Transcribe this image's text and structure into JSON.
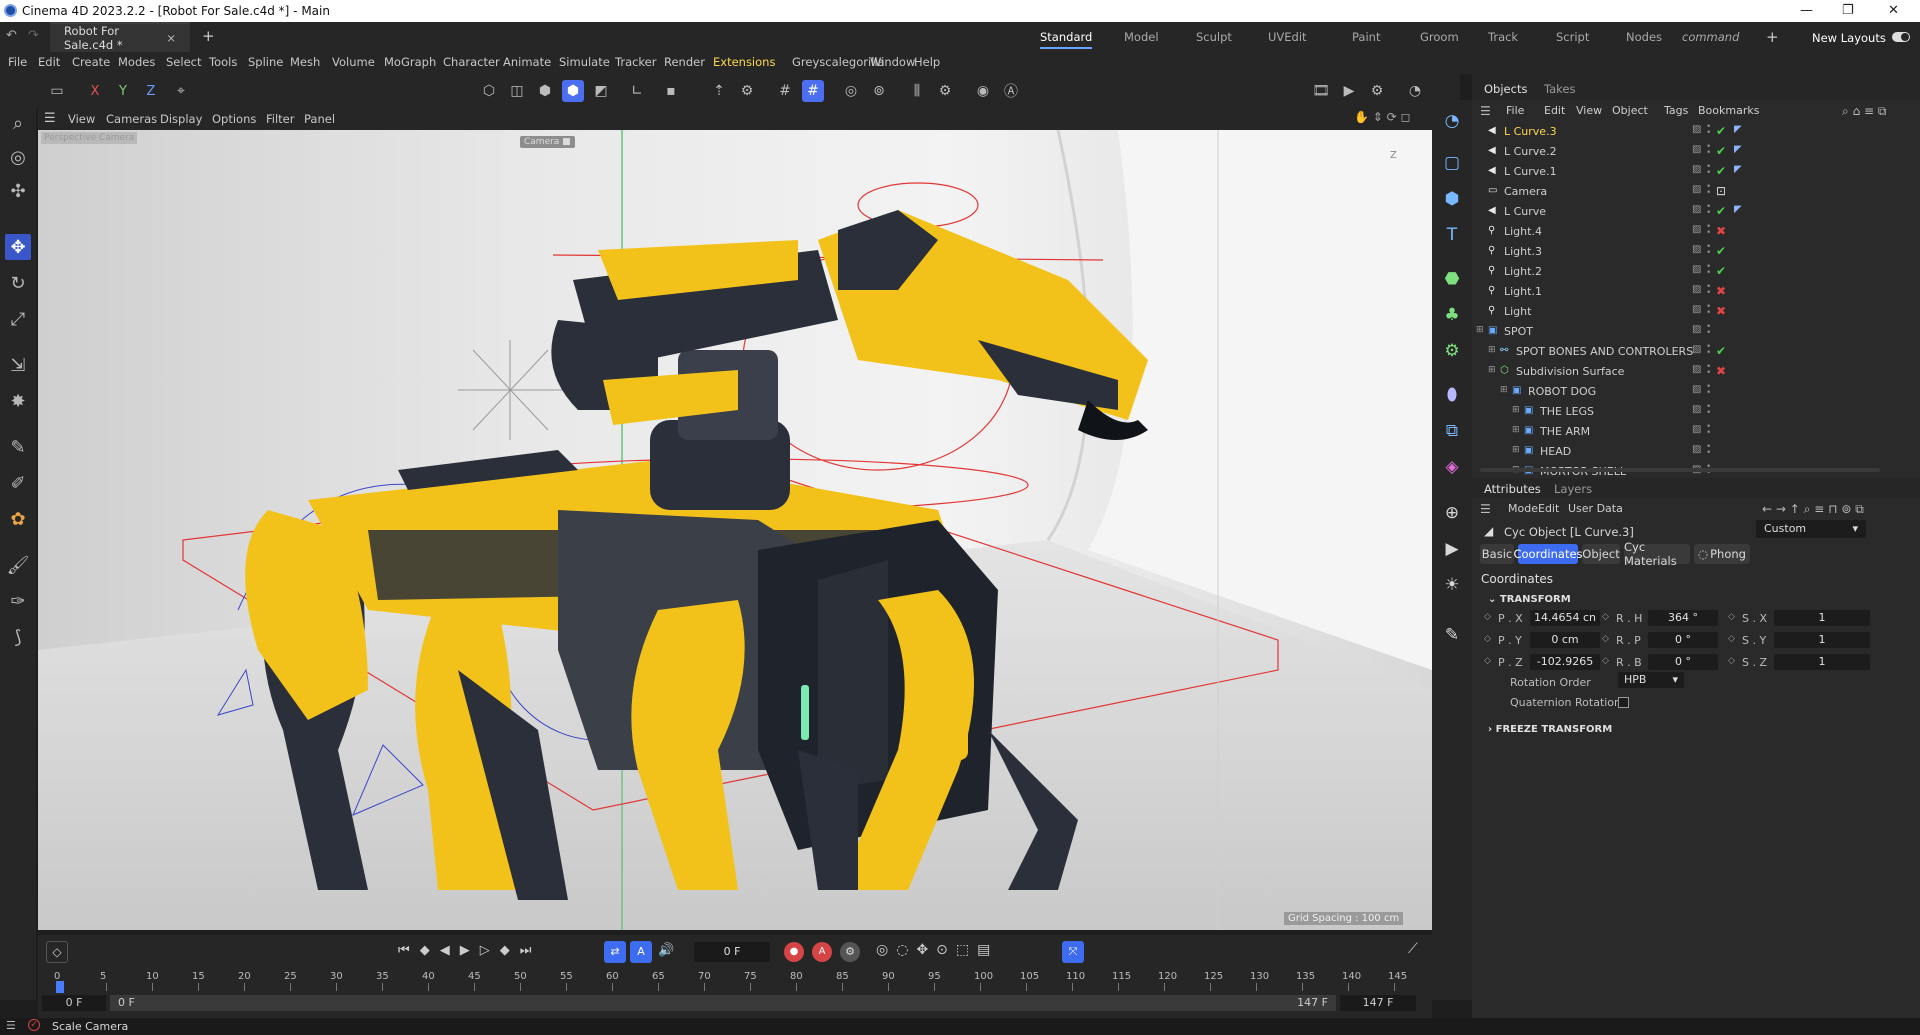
{
  "window": {
    "title": "Cinema 4D 2023.2.2 - [Robot For Sale.c4d *] - Main",
    "min": "—",
    "max": "❐",
    "close": "✕"
  },
  "doc_tab": {
    "label": "Robot For Sale.c4d *",
    "close": "×",
    "add": "+"
  },
  "layouts": {
    "items": [
      "Standard",
      "Model",
      "Sculpt",
      "UVEdit",
      "Paint",
      "Groom",
      "Track",
      "Script",
      "Nodes",
      "command"
    ],
    "active": "Standard",
    "add": "+",
    "new_layouts": "New Layouts"
  },
  "menu": [
    "File",
    "Edit",
    "Create",
    "Modes",
    "Select",
    "Tools",
    "Spline",
    "Mesh",
    "Volume",
    "MoGraph",
    "Character",
    "Animate",
    "Simulate",
    "Tracker",
    "Render",
    "Extensions",
    "Greyscalegorilla",
    "Window",
    "Help"
  ],
  "axis": {
    "x": "X",
    "y": "Y",
    "z": "Z"
  },
  "viewport": {
    "menu": [
      "View",
      "Cameras",
      "Display",
      "Options",
      "Filter",
      "Panel"
    ],
    "label_top": "Camera ■",
    "label_left": "Perspective Camera",
    "grid_spacing": "Grid Spacing : 100 cm",
    "axis_z": "Z",
    "colors": {
      "robot_yellow": "#f2c21a",
      "robot_dark": "#2b2f3a",
      "helper_red": "#e23636",
      "helper_blue": "#3b45c9",
      "helper_green": "#3fbf5a"
    }
  },
  "objects": {
    "tabs": [
      "Objects",
      "Takes"
    ],
    "menu": [
      "File",
      "Edit",
      "View",
      "Object",
      "Tags",
      "Bookmarks"
    ],
    "rows": [
      {
        "name": "L Curve.3",
        "indent": 0,
        "icon": "curve-icon",
        "selected": true,
        "tag": "check"
      },
      {
        "name": "L Curve.2",
        "indent": 0,
        "icon": "curve-icon",
        "tag": "check"
      },
      {
        "name": "L Curve.1",
        "indent": 0,
        "icon": "curve-icon",
        "tag": "check"
      },
      {
        "name": "Camera",
        "indent": 0,
        "icon": "camera-icon",
        "tag": "target"
      },
      {
        "name": "L Curve",
        "indent": 0,
        "icon": "curve-icon",
        "tag": "check"
      },
      {
        "name": "Light.4",
        "indent": 0,
        "icon": "light-icon",
        "tag": "cross"
      },
      {
        "name": "Light.3",
        "indent": 0,
        "icon": "light-icon",
        "tag": "check"
      },
      {
        "name": "Light.2",
        "indent": 0,
        "icon": "light-icon",
        "tag": "check"
      },
      {
        "name": "Light.1",
        "indent": 0,
        "icon": "light-icon",
        "tag": "cross"
      },
      {
        "name": "Light",
        "indent": 0,
        "icon": "light-icon",
        "tag": "cross"
      },
      {
        "name": "SPOT",
        "indent": 0,
        "icon": "null-icon",
        "tag": ""
      },
      {
        "name": "SPOT BONES AND CONTROLERS",
        "indent": 1,
        "icon": "bones-icon",
        "tag": "check"
      },
      {
        "name": "Subdivision Surface",
        "indent": 1,
        "icon": "subdiv-icon",
        "tag": "cross"
      },
      {
        "name": "ROBOT DOG",
        "indent": 2,
        "icon": "null-icon",
        "tag": ""
      },
      {
        "name": "THE LEGS",
        "indent": 3,
        "icon": "null-icon",
        "tag": ""
      },
      {
        "name": "THE ARM",
        "indent": 3,
        "icon": "null-icon",
        "tag": ""
      },
      {
        "name": "HEAD",
        "indent": 3,
        "icon": "null-icon",
        "tag": ""
      },
      {
        "name": "MORTOR SHELL",
        "indent": 3,
        "icon": "null-icon",
        "tag": ""
      }
    ]
  },
  "attributes": {
    "tabs": [
      "Attributes",
      "Layers"
    ],
    "menu": [
      "Mode",
      "Edit",
      "User Data"
    ],
    "object": "Cyc Object [L Curve.3]",
    "preset": "Custom",
    "buttons": [
      "Basic",
      "Coordinates",
      "Object",
      "Cyc Materials",
      "Phong"
    ],
    "active_button": "Coordinates",
    "section": "Coordinates",
    "transform_label": "TRANSFORM",
    "fields": {
      "px": {
        "label": "P . X",
        "value": "14.4654 cn"
      },
      "py": {
        "label": "P . Y",
        "value": "0 cm"
      },
      "pz": {
        "label": "P . Z",
        "value": "-102.9265"
      },
      "rh": {
        "label": "R . H",
        "value": "364 °"
      },
      "rp": {
        "label": "R . P",
        "value": "0 °"
      },
      "rb": {
        "label": "R . B",
        "value": "0 °"
      },
      "sx": {
        "label": "S . X",
        "value": "1"
      },
      "sy": {
        "label": "S . Y",
        "value": "1"
      },
      "sz": {
        "label": "S . Z",
        "value": "1"
      }
    },
    "rotation_order_label": "Rotation Order",
    "rotation_order": "HPB",
    "quaternion_label": "Quaternion Rotation",
    "freeze_label": "FREEZE TRANSFORM"
  },
  "timeline": {
    "frame": "0 F",
    "ticks": [
      "0",
      "5",
      "10",
      "15",
      "20",
      "25",
      "30",
      "35",
      "40",
      "45",
      "50",
      "55",
      "60",
      "65",
      "70",
      "75",
      "80",
      "85",
      "90",
      "95",
      "100",
      "105",
      "110",
      "115",
      "120",
      "125",
      "130",
      "135",
      "140",
      "145"
    ],
    "start": "0 F",
    "start2": "0 F",
    "end": "147 F",
    "end2": "147 F"
  },
  "status": {
    "text": "Scale Camera"
  }
}
